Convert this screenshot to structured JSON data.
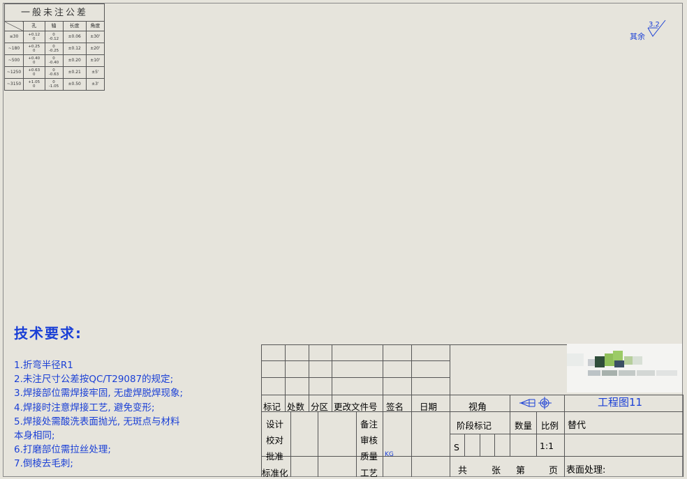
{
  "tolerance_table": {
    "title": "一般未注公差",
    "headers": [
      "孔",
      "轴",
      "长度",
      "角度"
    ],
    "rows": [
      {
        "range": "≤30",
        "hole": [
          "+0.12",
          "0"
        ],
        "shaft": [
          "0",
          "-0.12"
        ],
        "length": "±0.06",
        "angle": "±30'"
      },
      {
        "range": "~180",
        "hole": [
          "+0.25",
          "0"
        ],
        "shaft": [
          "0",
          "-0.25"
        ],
        "length": "±0.12",
        "angle": "±20'"
      },
      {
        "range": "~500",
        "hole": [
          "+0.40",
          "0"
        ],
        "shaft": [
          "0",
          "-0.40"
        ],
        "length": "±0.20",
        "angle": "±10'"
      },
      {
        "range": "~1250",
        "hole": [
          "+0.63",
          "0"
        ],
        "shaft": [
          "0",
          "-0.63"
        ],
        "length": "±0.21",
        "angle": "±5'"
      },
      {
        "range": "~3150",
        "hole": [
          "+1.05",
          "0"
        ],
        "shaft": [
          "0",
          "-1.05"
        ],
        "length": "±0.50",
        "angle": "±3'"
      }
    ]
  },
  "roughness": {
    "label": "其余",
    "value": "3.2"
  },
  "tech_requirements": {
    "title": "技术要求:",
    "items": [
      "1.折弯半径R1",
      "2.未注尺寸公差按QC/T29087的规定;",
      "3.焊接部位需焊接牢固, 无虚焊脱焊现象;",
      "4.焊接时注意焊接工艺, 避免变形;",
      "5.焊接处需酸洗表面抛光, 无斑点与材料",
      "本身相同;",
      "6.打磨部位需拉丝处理;",
      "7.倒棱去毛刺;"
    ]
  },
  "title_block": {
    "revision_headers": [
      "标记",
      "处数",
      "分区",
      "更改文件号",
      "签名",
      "日期"
    ],
    "sign_labels": [
      "设计",
      "校对",
      "批准",
      "标准化"
    ],
    "sign_right_labels": [
      "备注",
      "审核",
      "质量",
      "工艺"
    ],
    "quality_value": "KG",
    "view_label": "视角",
    "drawing_name": "工程图11",
    "stage_label": "阶段标记",
    "quantity_label": "数量",
    "scale_label": "比例",
    "replace_label": "替代",
    "stage_value": "S",
    "scale_value": "1:1",
    "sheet_labels": [
      "共",
      "张",
      "第",
      "页"
    ],
    "surface_label": "表面处理:"
  }
}
